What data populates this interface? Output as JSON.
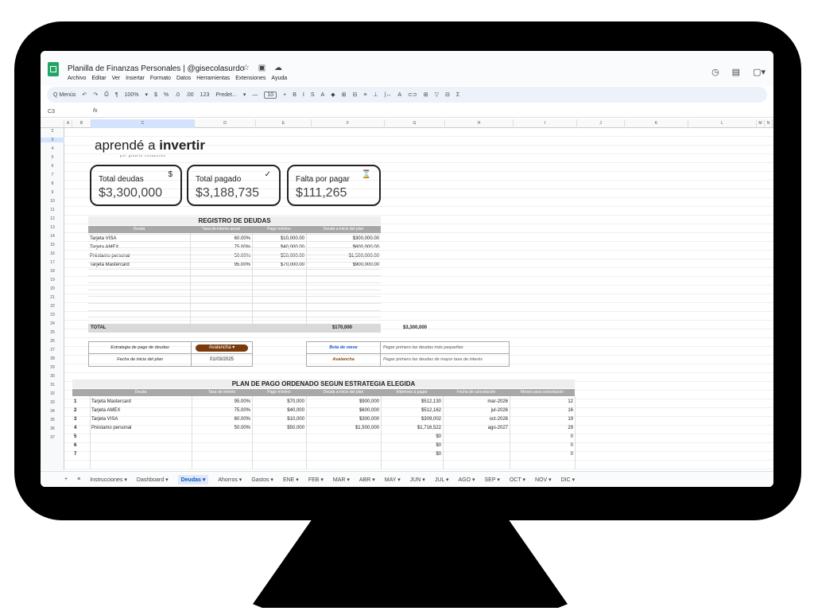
{
  "doc": {
    "title": "Planilla de Finanzas Personales | @gisecolasurdo",
    "title_icons": "☆ ▣ ☁",
    "menu": [
      "Archivo",
      "Editar",
      "Ver",
      "Insertar",
      "Formato",
      "Datos",
      "Herramientas",
      "Extensiones",
      "Ayuda"
    ],
    "right_icons": [
      "◷",
      "▤",
      "▢▾"
    ]
  },
  "toolbar": {
    "menus": "Q Menús",
    "items": [
      "↶",
      "↷",
      "⎙",
      "¶",
      "100%",
      "▾",
      "$",
      "%",
      ".0",
      ".00",
      "123",
      "Predet...",
      "▾",
      "—"
    ],
    "font_size": "10",
    "format_items": [
      "+",
      "B",
      "I",
      "S",
      "A",
      "◆",
      "⊞",
      "⊟",
      "≡",
      "⊥",
      "|↔",
      "A",
      "⊂⊃",
      "⊞",
      "▽",
      "⊟",
      "Σ"
    ]
  },
  "formula": {
    "ref": "C3",
    "fx": "fx"
  },
  "columns": [
    {
      "label": "A",
      "w": 10
    },
    {
      "label": "B",
      "w": 24
    },
    {
      "label": "C",
      "w": 130
    },
    {
      "label": "D",
      "w": 77
    },
    {
      "label": "E",
      "w": 70
    },
    {
      "label": "F",
      "w": 92
    },
    {
      "label": "G",
      "w": 76
    },
    {
      "label": "H",
      "w": 86
    },
    {
      "label": "I",
      "w": 80
    },
    {
      "label": "J",
      "w": 60
    },
    {
      "label": "K",
      "w": 80
    },
    {
      "label": "L",
      "w": 86
    },
    {
      "label": "M",
      "w": 10
    },
    {
      "label": "N",
      "w": 10
    }
  ],
  "rows": [
    "2",
    "3",
    "4",
    "5",
    "6",
    "7",
    "8",
    "9",
    "10",
    "11",
    "12",
    "13",
    "14",
    "15",
    "16",
    "17",
    "18",
    "19",
    "20",
    "21",
    "22",
    "23",
    "24",
    "25",
    "26",
    "27",
    "28",
    "29",
    "30",
    "31",
    "32",
    "33",
    "34",
    "35",
    "36",
    "37"
  ],
  "brand": {
    "main": "aprendé a ",
    "bold": "invertir",
    "sub": "por giselle colasurdo"
  },
  "cards": [
    {
      "label": "Total deudas",
      "value": "$3,300,000",
      "icon": "$"
    },
    {
      "label": "Total pagado",
      "value": "$3,188,735",
      "icon": "✓"
    },
    {
      "label": "Falta por pagar",
      "value": "$111,265",
      "icon": "⌛"
    }
  ],
  "registro": {
    "title": "REGISTRO DE DEUDAS",
    "headers": [
      "Deuda",
      "Tasa de interés anual",
      "Pago mínimo",
      "Deuda a inicio del plan"
    ],
    "rows": [
      [
        "Tarjeta VISA",
        "60.00%",
        "$10,000.00",
        "$300,000.00"
      ],
      [
        "Tarjeta AMEX",
        "75.00%",
        "$40,000.00",
        "$600,000.00"
      ],
      [
        "Préstamo personal",
        "50.00%",
        "$50,000.00",
        "$1,500,000.00"
      ],
      [
        "Tarjeta Mastercard",
        "95.00%",
        "$70,000.00",
        "$900,000.00"
      ]
    ],
    "total_label": "TOTAL",
    "total_min": "$170,000",
    "total_debt": "$3,300,000"
  },
  "strategy": {
    "label": "Estrategia de pago de deudas",
    "value": "Avalancha",
    "date_label": "Fecha de inicio del plan",
    "date": "01/03/2025",
    "opt1": "Bola de nieve",
    "desc1": "Pagar primero las deudas más pequeñas",
    "opt2": "Avalancha",
    "desc2": "Pagar primero las deudas de mayor tasa de interés"
  },
  "plan": {
    "title": "PLAN DE PAGO ORDENADO SEGUN ESTRATEGIA ELEGIDA",
    "headers": [
      "Deuda",
      "Tasa de interés",
      "Pago mínimo",
      "Deuda a inicio del plan",
      "Intereses a pagar",
      "Fecha de cancelación",
      "Meses para cancelación"
    ],
    "rows": [
      [
        "1",
        "Tarjeta Mastercard",
        "95.00%",
        "$70,000",
        "$900,000",
        "$512,130",
        "mar-2026",
        "12"
      ],
      [
        "2",
        "Tarjeta AMEX",
        "75.00%",
        "$40,000",
        "$600,000",
        "$512,162",
        "jul-2026",
        "16"
      ],
      [
        "3",
        "Tarjeta VISA",
        "60.00%",
        "$10,000",
        "$300,000",
        "$309,002",
        "oct-2026",
        "19"
      ],
      [
        "4",
        "Préstamo personal",
        "50.00%",
        "$50,000",
        "$1,500,000",
        "$1,716,522",
        "ago-2027",
        "29"
      ],
      [
        "5",
        "",
        "",
        "",
        "",
        "$0",
        "",
        "0"
      ],
      [
        "6",
        "",
        "",
        "",
        "",
        "$0",
        "",
        "0"
      ],
      [
        "7",
        "",
        "",
        "",
        "",
        "$0",
        "",
        "0"
      ]
    ]
  },
  "tabs": [
    "Instrucciones ▾",
    "Dashboard ▾",
    "Deudas ▾",
    "Ahorros ▾",
    "Gastos ▾",
    "ENE ▾",
    "FEB ▾",
    "MAR ▾",
    "ABR ▾",
    "MAY ▾",
    "JUN ▾",
    "JUL ▾",
    "AGO ▾",
    "SEP ▾",
    "OCT ▾",
    "NOV ▾",
    "DIC ▾"
  ],
  "tabs_active": "Deudas ▾",
  "tab_controls": [
    "+",
    "≡"
  ]
}
